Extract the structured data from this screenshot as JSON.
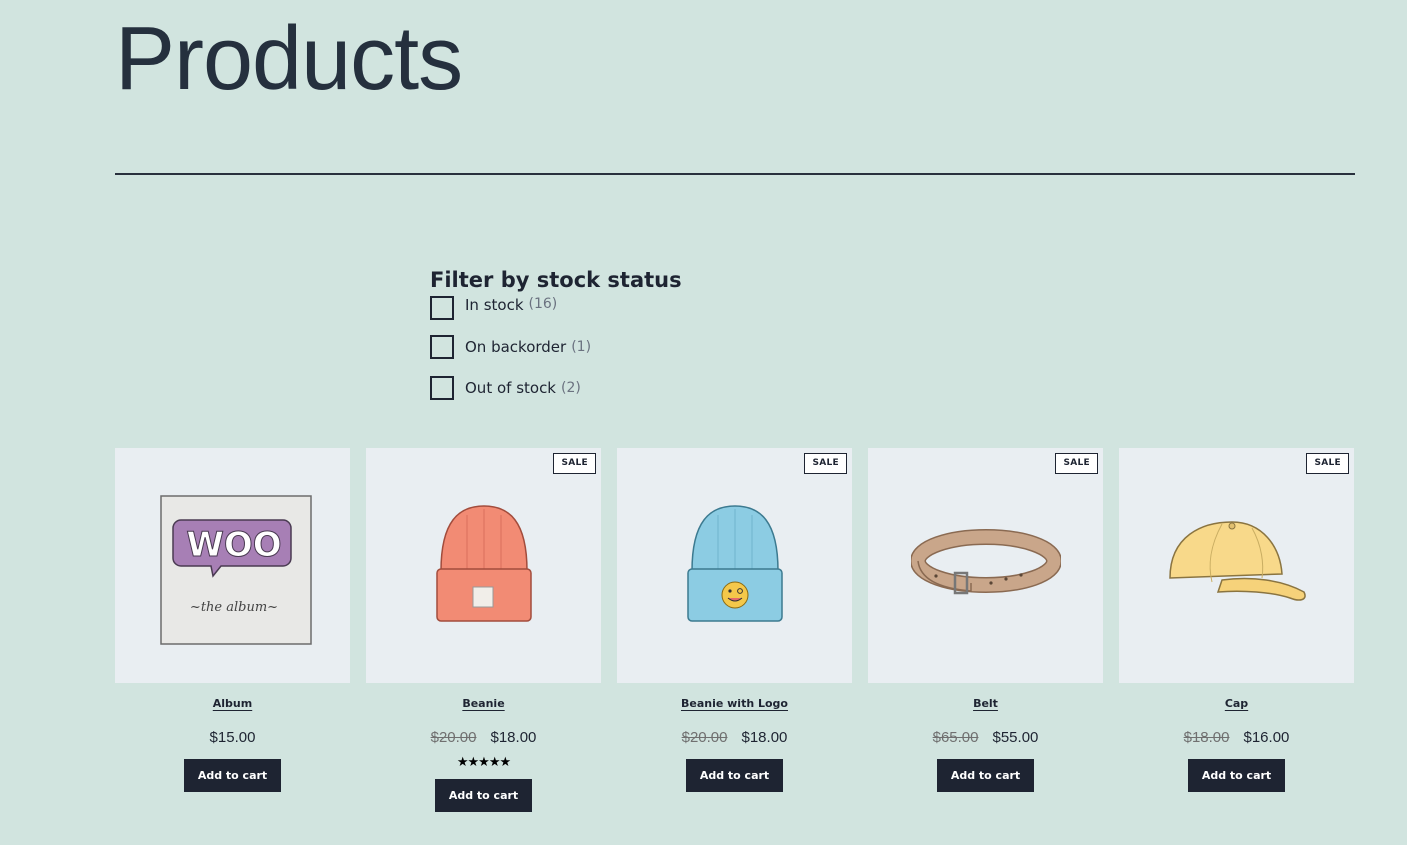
{
  "page": {
    "title": "Products"
  },
  "filter": {
    "title": "Filter by stock status",
    "options": [
      {
        "label": "In stock",
        "count": "(16)"
      },
      {
        "label": "On backorder",
        "count": "(1)"
      },
      {
        "label": "Out of stock",
        "count": "(2)"
      }
    ]
  },
  "products": [
    {
      "name": "Album",
      "price": "$15.00",
      "button": "Add to cart",
      "icon": "album-icon"
    },
    {
      "name": "Beanie",
      "sale_badge": "SALE",
      "old_price": "$20.00",
      "price": "$18.00",
      "rating": "★★★★★",
      "rating_value": 4.5,
      "button": "Add to cart",
      "icon": "beanie-icon"
    },
    {
      "name": "Beanie with Logo",
      "sale_badge": "SALE",
      "old_price": "$20.00",
      "price": "$18.00",
      "button": "Add to cart",
      "icon": "beanie-logo-icon"
    },
    {
      "name": "Belt",
      "sale_badge": "SALE",
      "old_price": "$65.00",
      "price": "$55.00",
      "button": "Add to cart",
      "icon": "belt-icon"
    },
    {
      "name": "Cap",
      "sale_badge": "SALE",
      "old_price": "$18.00",
      "price": "$16.00",
      "button": "Add to cart",
      "icon": "cap-icon"
    }
  ],
  "colors": {
    "background": "#d1e4df",
    "text": "#1e2432",
    "thumb_bg": "#e9eef2",
    "button_bg": "#1e2432"
  },
  "album_art": {
    "logo_text": "WOO",
    "caption": "~the album~"
  }
}
